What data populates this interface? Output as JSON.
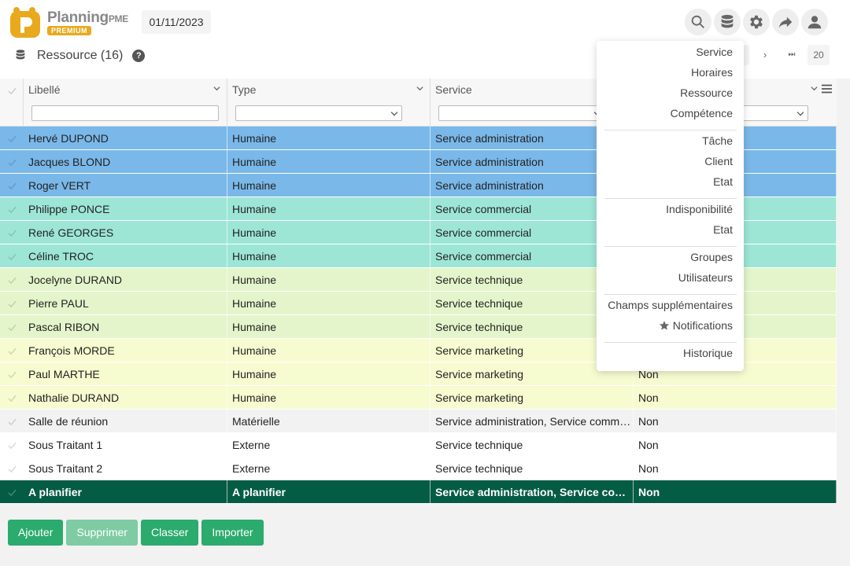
{
  "app": {
    "brand_main": "Planning",
    "brand_pme": "PME",
    "premium": "PREMIUM",
    "date": "01/11/2023"
  },
  "header_icons": [
    "search-icon",
    "database-icon",
    "gear-icon",
    "share-icon",
    "user-icon"
  ],
  "page": {
    "title": "Ressource (16)",
    "help": "?"
  },
  "pager": {
    "next": "›",
    "last": "⏭",
    "page_size": "20"
  },
  "columns": [
    {
      "label": "Libellé"
    },
    {
      "label": "Type"
    },
    {
      "label": "Service"
    },
    {
      "label": ""
    }
  ],
  "colors": {
    "accent": "#2bab6e",
    "row_dark": "#055c44",
    "blue": "#7ab8e9",
    "teal": "#9de6d6",
    "lightgreen": "#e4f5cb",
    "yellow": "#f7fbd0",
    "grey": "#f2f2f2",
    "white": "#ffffff"
  },
  "rows": [
    {
      "libelle": "Hervé DUPOND",
      "type": "Humaine",
      "service": "Service administration",
      "col4": "",
      "color": "#7ab8e9"
    },
    {
      "libelle": "Jacques BLOND",
      "type": "Humaine",
      "service": "Service administration",
      "col4": "",
      "color": "#7ab8e9"
    },
    {
      "libelle": "Roger VERT",
      "type": "Humaine",
      "service": "Service administration",
      "col4": "",
      "color": "#7ab8e9"
    },
    {
      "libelle": "Philippe PONCE",
      "type": "Humaine",
      "service": "Service commercial",
      "col4": "",
      "color": "#9de6d6"
    },
    {
      "libelle": "René GEORGES",
      "type": "Humaine",
      "service": "Service commercial",
      "col4": "",
      "color": "#9de6d6"
    },
    {
      "libelle": "Céline TROC",
      "type": "Humaine",
      "service": "Service commercial",
      "col4": "",
      "color": "#9de6d6"
    },
    {
      "libelle": "Jocelyne DURAND",
      "type": "Humaine",
      "service": "Service technique",
      "col4": "",
      "color": "#e4f5cb"
    },
    {
      "libelle": "Pierre PAUL",
      "type": "Humaine",
      "service": "Service technique",
      "col4": "",
      "color": "#e4f5cb"
    },
    {
      "libelle": "Pascal RIBON",
      "type": "Humaine",
      "service": "Service technique",
      "col4": "",
      "color": "#e4f5cb"
    },
    {
      "libelle": "François MORDE",
      "type": "Humaine",
      "service": "Service marketing",
      "col4": "",
      "color": "#f7fbd0"
    },
    {
      "libelle": "Paul MARTHE",
      "type": "Humaine",
      "service": "Service marketing",
      "col4": "Non",
      "color": "#f7fbd0"
    },
    {
      "libelle": "Nathalie DURAND",
      "type": "Humaine",
      "service": "Service marketing",
      "col4": "Non",
      "color": "#f7fbd0"
    },
    {
      "libelle": "Salle de réunion",
      "type": "Matérielle",
      "service": "Service administration, Service commercial",
      "col4": "Non",
      "color": "#f2f2f2"
    },
    {
      "libelle": "Sous Traitant 1",
      "type": "Externe",
      "service": "Service technique",
      "col4": "Non",
      "color": "#ffffff"
    },
    {
      "libelle": "Sous Traitant 2",
      "type": "Externe",
      "service": "Service technique",
      "col4": "Non",
      "color": "#ffffff"
    },
    {
      "libelle": "A planifier",
      "type": "A planifier",
      "service": "Service administration, Service commercial",
      "col4": "Non",
      "color": "#055c44",
      "dark": true
    }
  ],
  "buttons": {
    "add": "Ajouter",
    "delete": "Supprimer",
    "sort": "Classer",
    "import": "Importer"
  },
  "menu": {
    "groups": [
      [
        "Service",
        "Horaires",
        "Ressource",
        "Compétence"
      ],
      [
        "Tâche",
        "Client",
        "Etat"
      ],
      [
        "Indisponibilité",
        "Etat"
      ],
      [
        "Groupes",
        "Utilisateurs"
      ],
      [
        "Champs supplémentaires",
        "Notifications"
      ],
      [
        "Historique"
      ]
    ]
  }
}
